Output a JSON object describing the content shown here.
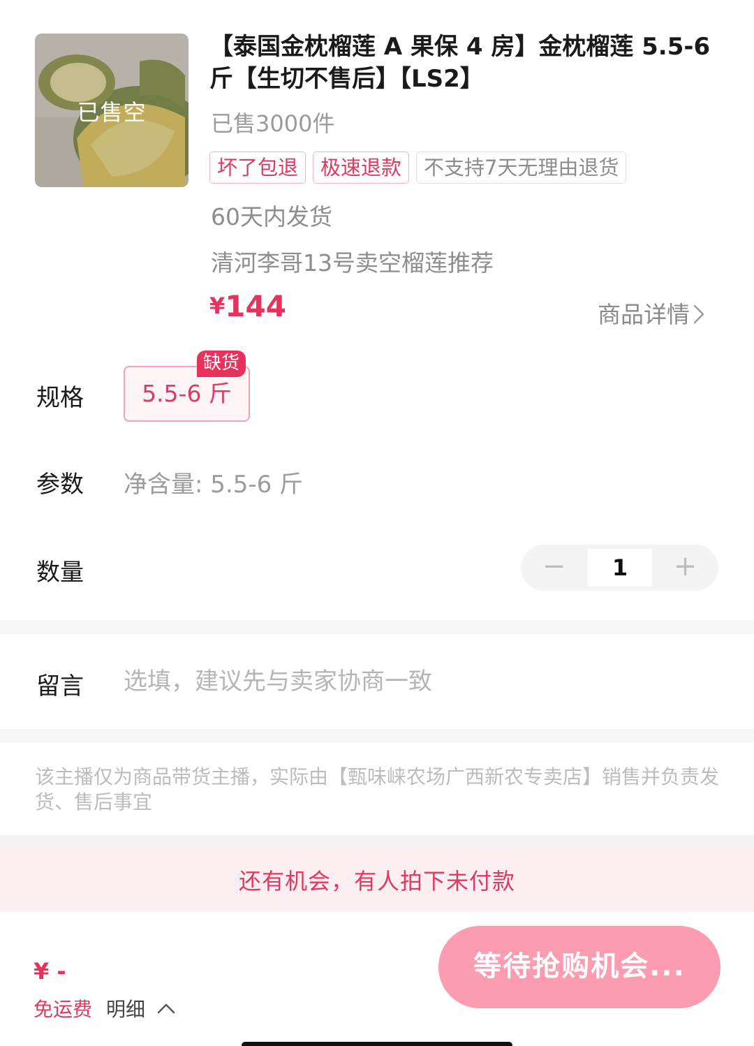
{
  "product": {
    "image_overlay": "已售空",
    "title": "【泰国金枕榴莲 A 果保 4 房】金枕榴莲 5.5-6 斤【生切不售后】【LS2】",
    "sold_count": "已售3000件",
    "tags": [
      "坏了包退",
      "极速退款",
      "不支持7天无理由退货"
    ],
    "shipping": "60天内发货",
    "recommendation": "清河李哥13号卖空榴莲推荐",
    "price_currency": "¥",
    "price": "144",
    "detail_link": "商品详情"
  },
  "spec": {
    "label": "规格",
    "option": "5.5-6 斤",
    "badge": "缺货"
  },
  "params": {
    "label": "参数",
    "value": "净含量: 5.5-6 斤"
  },
  "quantity": {
    "label": "数量",
    "minus": "−",
    "value": "1",
    "plus": "+"
  },
  "message": {
    "label": "留言",
    "placeholder": "选填，建议先与卖家协商一致"
  },
  "notice": "该主播仅为商品带货主播，实际由【甄味崃农场广西新农专卖店】销售并负责发货、售后事宜",
  "banner": "还有机会，有人拍下未付款",
  "footer": {
    "total": "¥ -",
    "free_shipping": "免运费",
    "breakdown": "明细",
    "buy_button": "等待抢购机会..."
  },
  "colors": {
    "accent": "#e8325b",
    "button": "#fb9cb0",
    "banner_bg": "#fdeef1"
  }
}
